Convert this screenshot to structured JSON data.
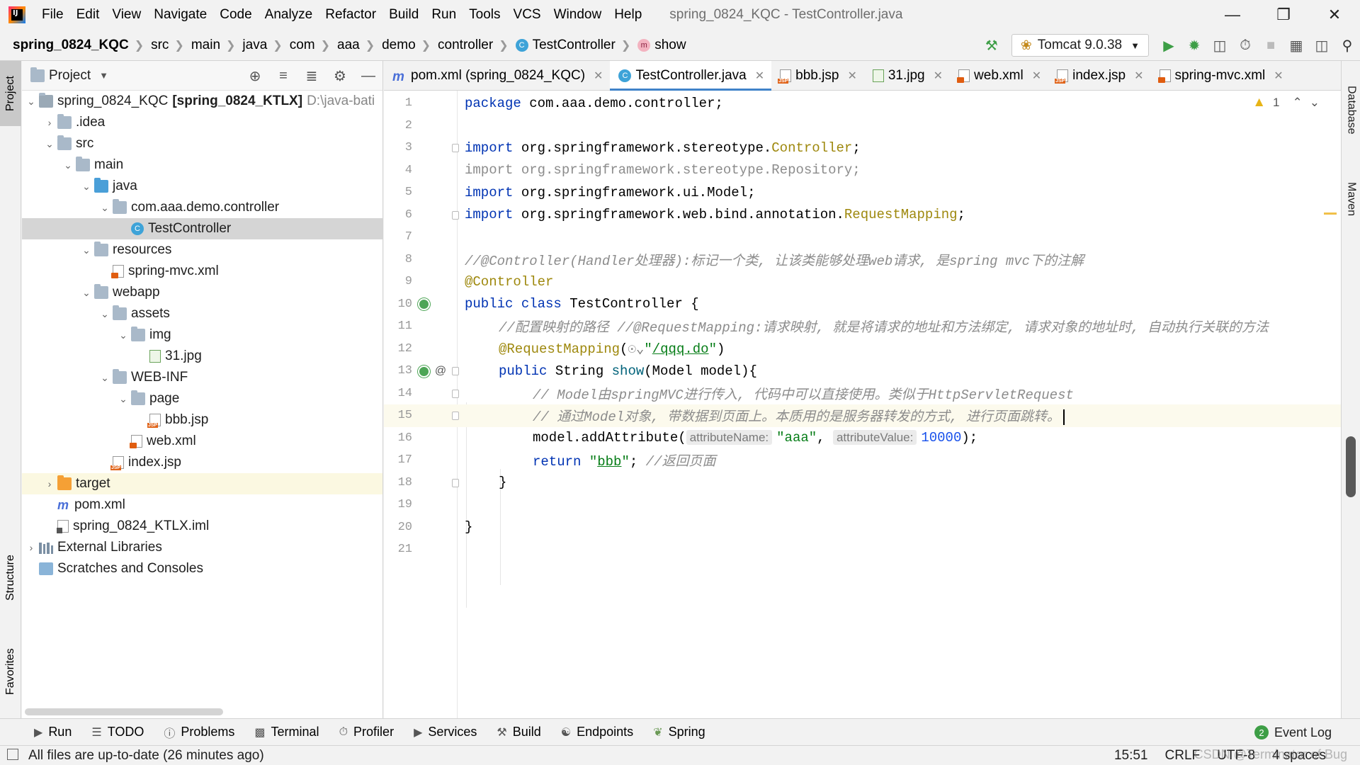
{
  "menu": [
    "File",
    "Edit",
    "View",
    "Navigate",
    "Code",
    "Analyze",
    "Refactor",
    "Build",
    "Run",
    "Tools",
    "VCS",
    "Window",
    "Help"
  ],
  "window_title": "spring_0824_KQC - TestController.java",
  "breadcrumb": [
    "spring_0824_KQC",
    "src",
    "main",
    "java",
    "com",
    "aaa",
    "demo",
    "controller",
    "TestController",
    "show"
  ],
  "run_config": "Tomcat 9.0.38",
  "left_tabs": {
    "project": "Project",
    "structure": "Structure",
    "favorites": "Favorites"
  },
  "right_tabs": {
    "database": "Database",
    "maven": "Maven"
  },
  "project_panel": {
    "title": "Project",
    "tree": [
      {
        "label": "spring_0824_KQC",
        "extra": "[spring_0824_KTLX]",
        "path": "D:\\java-bati"
      },
      {
        "label": ".idea"
      },
      {
        "label": "src"
      },
      {
        "label": "main"
      },
      {
        "label": "java"
      },
      {
        "label": "com.aaa.demo.controller"
      },
      {
        "label": "TestController"
      },
      {
        "label": "resources"
      },
      {
        "label": "spring-mvc.xml"
      },
      {
        "label": "webapp"
      },
      {
        "label": "assets"
      },
      {
        "label": "img"
      },
      {
        "label": "31.jpg"
      },
      {
        "label": "WEB-INF"
      },
      {
        "label": "page"
      },
      {
        "label": "bbb.jsp"
      },
      {
        "label": "web.xml"
      },
      {
        "label": "index.jsp"
      },
      {
        "label": "target"
      },
      {
        "label": "pom.xml"
      },
      {
        "label": "spring_0824_KTLX.iml"
      },
      {
        "label": "External Libraries"
      },
      {
        "label": "Scratches and Consoles"
      }
    ]
  },
  "tabs": [
    {
      "label": "pom.xml (spring_0824_KQC)"
    },
    {
      "label": "TestController.java"
    },
    {
      "label": "bbb.jsp"
    },
    {
      "label": "31.jpg"
    },
    {
      "label": "web.xml"
    },
    {
      "label": "index.jsp"
    },
    {
      "label": "spring-mvc.xml"
    }
  ],
  "editor": {
    "warning_count": "1",
    "line_numbers": [
      "1",
      "2",
      "3",
      "4",
      "5",
      "6",
      "7",
      "8",
      "9",
      "10",
      "11",
      "12",
      "13",
      "14",
      "15",
      "16",
      "17",
      "18",
      "19",
      "20",
      "21"
    ],
    "code": {
      "l1_kw": "package",
      "l1_rest": " com.aaa.demo.controller;",
      "l3_kw": "import",
      "l3_rest": " org.springframework.stereotype.",
      "l3_cls": "Controller",
      "l3_end": ";",
      "l4": "import org.springframework.stereotype.Repository;",
      "l5_kw": "import",
      "l5_rest": " org.springframework.ui.Model;",
      "l6_kw": "import",
      "l6_rest": " org.springframework.web.bind.annotation.",
      "l6_cls": "RequestMapping",
      "l6_end": ";",
      "l8": "//@Controller(Handler处理器):标记一个类, 让该类能够处理web请求, 是spring mvc下的注解",
      "l9": "@Controller",
      "l10_kw": "public class",
      "l10_rest": " TestController {",
      "l11": "//配置映射的路径 //@RequestMapping:请求映射, 就是将请求的地址和方法绑定, 请求对象的地址时, 自动执行关联的方法",
      "l12_ann": "@RequestMapping",
      "l12_open": "(",
      "l12_q1": "\"",
      "l12_url": "/qqq.do",
      "l12_q2": "\"",
      "l12_close": ")",
      "l13_kw": "public",
      "l13_type": " String ",
      "l13_fn": "show",
      "l13_rest": "(Model model){",
      "l14": "// Model由springMVC进行传入, 代码中可以直接使用。类似于HttpServletRequest",
      "l15": "// 通过Model对象, 带数据到页面上。本质用的是服务器转发的方式, 进行页面跳转。",
      "l16_pre": "model.addAttribute(",
      "l16_hint1": "attributeName:",
      "l16_str": "\"aaa\"",
      "l16_comma": ", ",
      "l16_hint2": "attributeValue:",
      "l16_num": "10000",
      "l16_end": ");",
      "l17_kw": "return",
      "l17_q1": " \"",
      "l17_val": "bbb",
      "l17_q2": "\"",
      "l17_semi": "; ",
      "l17_cmt": "//返回页面",
      "l18": "}",
      "l20": "}"
    }
  },
  "bottom_tools": [
    "Run",
    "TODO",
    "Problems",
    "Terminal",
    "Profiler",
    "Services",
    "Build",
    "Endpoints",
    "Spring"
  ],
  "event_log": {
    "label": "Event Log",
    "count": "2"
  },
  "status": {
    "message": "All files are up-to-date (26 minutes ago)",
    "time": "15:51",
    "line_sep": "CRLF",
    "encoding": "UTF-8",
    "indent": "4 spaces",
    "watermark": "CSDN @Terminator of Bug"
  }
}
